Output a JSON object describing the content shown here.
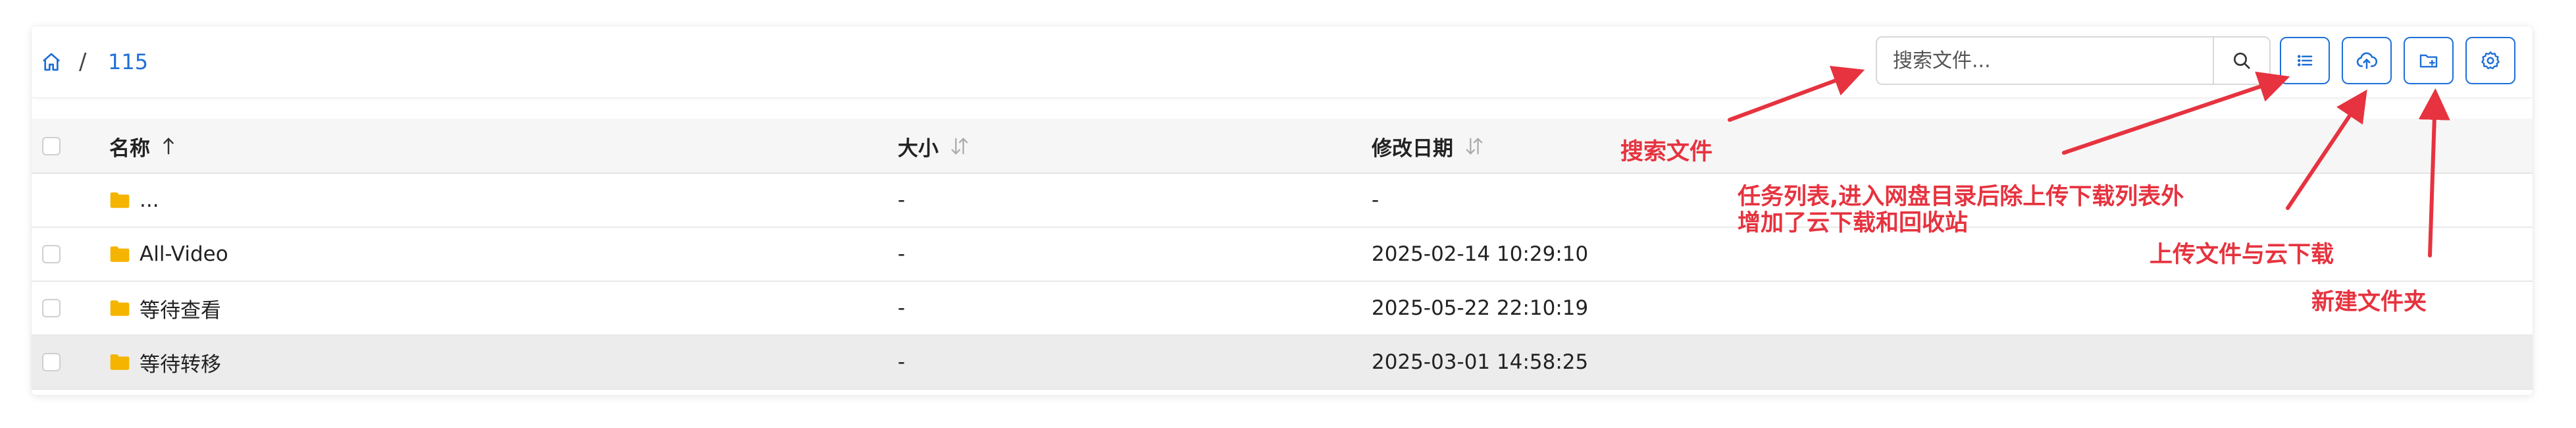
{
  "breadcrumb": {
    "home_icon": "home-icon",
    "separator": "/",
    "current": "115"
  },
  "search": {
    "placeholder": "搜索文件...",
    "button_icon": "search-icon"
  },
  "toolbar": {
    "task_list_icon": "list-icon",
    "upload_icon": "cloud-upload-icon",
    "new_folder_icon": "folder-plus-icon",
    "settings_icon": "gear-icon"
  },
  "table": {
    "columns": {
      "name": "名称",
      "size": "大小",
      "modified": "修改日期"
    },
    "rows": [
      {
        "name": "...",
        "size": "-",
        "modified": "-"
      },
      {
        "name": "All-Video",
        "size": "-",
        "modified": "2025-02-14 10:29:10"
      },
      {
        "name": "等待查看",
        "size": "-",
        "modified": "2025-05-22 22:10:19"
      },
      {
        "name": "等待转移",
        "size": "-",
        "modified": "2025-03-01 14:58:25"
      }
    ]
  },
  "annotations": {
    "search": "搜索文件",
    "tasks_line1": "任务列表,进入网盘目录后除上传下载列表外",
    "tasks_line2": "增加了云下载和回收站",
    "upload": "上传文件与云下载",
    "new_folder": "新建文件夹"
  },
  "colors": {
    "accent": "#1f6fd6",
    "folder": "#f5b400",
    "annotation": "#e6333f"
  }
}
